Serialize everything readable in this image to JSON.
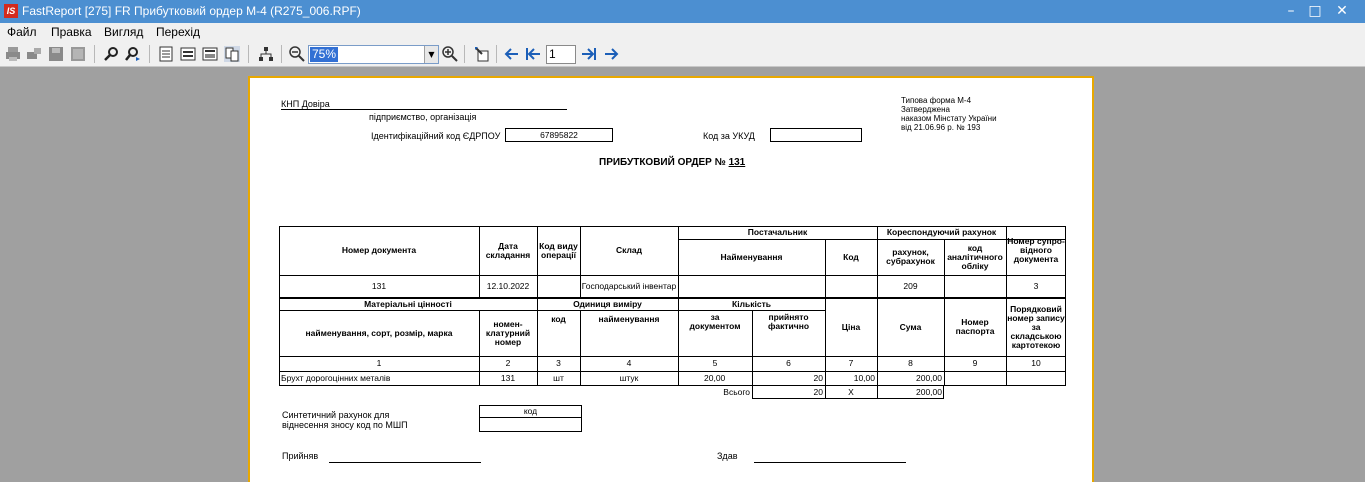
{
  "window": {
    "logo_text": "IS",
    "title": "FastReport [275] FR Прибутковий ордер М-4  (R275_006.RPF)",
    "minimize": "–",
    "maximize": "□",
    "close": "✕"
  },
  "menu": [
    "Файл",
    "Правка",
    "Вигляд",
    "Перехід"
  ],
  "toolbar": {
    "zoom_value": "75%",
    "page_number": "1",
    "icons": [
      "print-icon",
      "print-setup-icon",
      "save-icon",
      "export-icon",
      "find-icon",
      "find-next-icon",
      "page-view-icon",
      "page-width-icon",
      "one-page-icon",
      "two-pages-icon",
      "outline-icon",
      "zoom-out-icon",
      "zoom-in-icon",
      "edit-icon",
      "prev-page-icon",
      "first-page-icon",
      "last-page-icon",
      "next-page-icon"
    ]
  },
  "report": {
    "org_name": "КНП Довіра",
    "org_caption": "підприємство, організація",
    "edrpou_label": "Ідентифікаційний код ЄДРПОУ",
    "edrpou_value": "67895822",
    "ukud_label": "Код за УКУД",
    "ukud_value": "",
    "form_info": [
      "Типова форма М-4",
      "Затверджена",
      "наказом Мінстату України",
      "від 21.06.96 р. № 193"
    ],
    "title_prefix": "ПРИБУТКОВИЙ ОРДЕР №",
    "title_number": "131",
    "t1": {
      "h_doc_number": "Номер документа",
      "h_date": "Дата складання",
      "h_op_code": "Код виду операції",
      "h_warehouse": "Склад",
      "h_supplier": "Постачальник",
      "h_supplier_name": "Найменування",
      "h_supplier_code": "Код",
      "h_corr_account": "Кореспондуючий рахунок",
      "h_account": "рахунок, субрахунок",
      "h_analytic_code": "код аналітичного обліку",
      "h_accomp_doc": "Номер супро-відного документа",
      "doc_number": "131",
      "date": "12.10.2022",
      "op_code": "",
      "warehouse": "Господарський інвентар",
      "supplier_name": "",
      "supplier_code": "",
      "account": "209",
      "analytic_code": "",
      "accomp_doc": "3"
    },
    "t2": {
      "h_valuables": "Матеріальні цінності",
      "h_name": "найменування, сорт, розмір, марка",
      "h_nomenclature": "номен-клатурний номер",
      "h_unit": "Одиниця виміру",
      "h_unit_code": "код",
      "h_unit_name": "найменування",
      "h_quantity": "Кількість",
      "h_qty_doc": "за документом",
      "h_qty_actual": "прийнято фактично",
      "h_price": "Ціна",
      "h_sum": "Сума",
      "h_passport": "Номер паспорта",
      "h_seq": "Порядковий номер запису за складською картотекою",
      "col_numbers": [
        "1",
        "2",
        "3",
        "4",
        "5",
        "6",
        "7",
        "8",
        "9",
        "10"
      ],
      "rows": [
        {
          "name": "Брухт дорогоцінних металів",
          "nomenclature": "131",
          "unit_code": "шт",
          "unit_name": "штук",
          "qty_doc": "20,00",
          "qty_actual": "20",
          "price": "10,00",
          "sum": "200,00",
          "passport": "",
          "seq": ""
        }
      ],
      "total_label": "Всього",
      "total_qty_actual": "20",
      "total_price": "Х",
      "total_sum": "200,00"
    },
    "synthetic_label_1": "Синтетичний рахунок для",
    "synthetic_label_2": "віднесення зносу код по МШП",
    "synthetic_code_header": "код",
    "synthetic_code_value": "",
    "received_label": "Прийняв",
    "handed_label": "Здав"
  }
}
